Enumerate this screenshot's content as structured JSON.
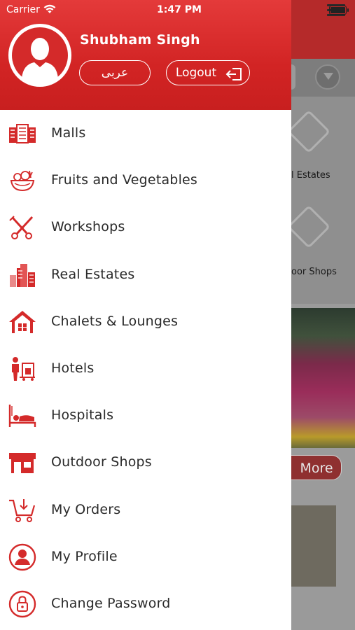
{
  "status_bar": {
    "carrier": "Carrier",
    "time": "1:47 PM"
  },
  "drawer": {
    "user_name": "Shubham Singh",
    "arabic_button": "عربى",
    "logout_button": "Logout",
    "items": [
      {
        "label": "Malls",
        "icon": "mall-icon"
      },
      {
        "label": "Fruits and Vegetables",
        "icon": "fruits-vegetables-icon"
      },
      {
        "label": "Workshops",
        "icon": "workshop-tools-icon"
      },
      {
        "label": "Real Estates",
        "icon": "buildings-icon"
      },
      {
        "label": "Chalets & Lounges",
        "icon": "chalet-house-icon"
      },
      {
        "label": "Hotels",
        "icon": "hotel-porter-icon"
      },
      {
        "label": "Hospitals",
        "icon": "hospital-bed-icon"
      },
      {
        "label": "Outdoor Shops",
        "icon": "shop-icon"
      },
      {
        "label": "My Orders",
        "icon": "cart-icon"
      },
      {
        "label": "My Profile",
        "icon": "profile-icon"
      },
      {
        "label": "Change Password",
        "icon": "lock-icon"
      }
    ]
  },
  "background": {
    "tile_labels": [
      "l Estates",
      "oor Shops"
    ],
    "more_button": "More"
  },
  "colors": {
    "accent": "#d42a2a",
    "drawer_bg": "#ffffff",
    "text": "#2a2a2a"
  }
}
